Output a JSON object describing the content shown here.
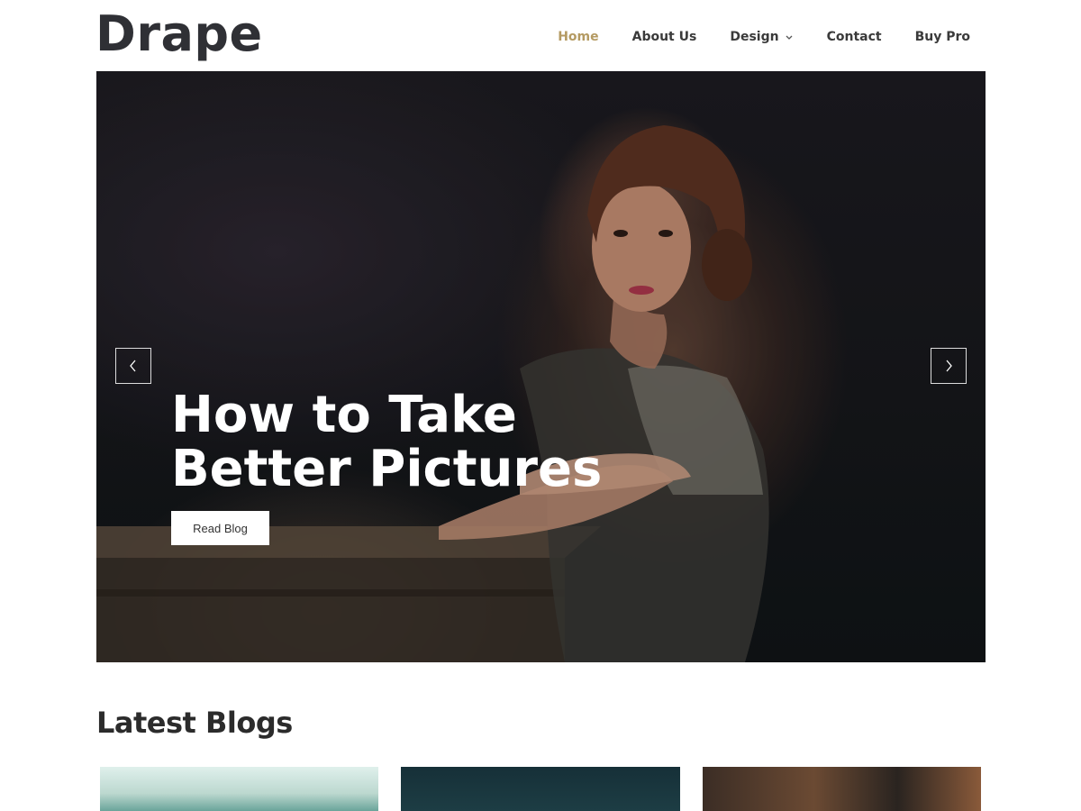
{
  "header": {
    "logo": "Drape",
    "nav": [
      {
        "label": "Home",
        "active": true
      },
      {
        "label": "About Us",
        "active": false
      },
      {
        "label": "Design",
        "active": false,
        "has_dropdown": true
      },
      {
        "label": "Contact",
        "active": false
      },
      {
        "label": "Buy Pro",
        "active": false
      }
    ]
  },
  "hero": {
    "title": "How to Take Better Pictures",
    "button_label": "Read Blog",
    "prev_icon": "chevron-left-icon",
    "next_icon": "chevron-right-icon"
  },
  "latest": {
    "title": "Latest Blogs"
  },
  "colors": {
    "accent": "#b49a62",
    "text": "#2b2b2b",
    "logo": "#2f3035"
  }
}
